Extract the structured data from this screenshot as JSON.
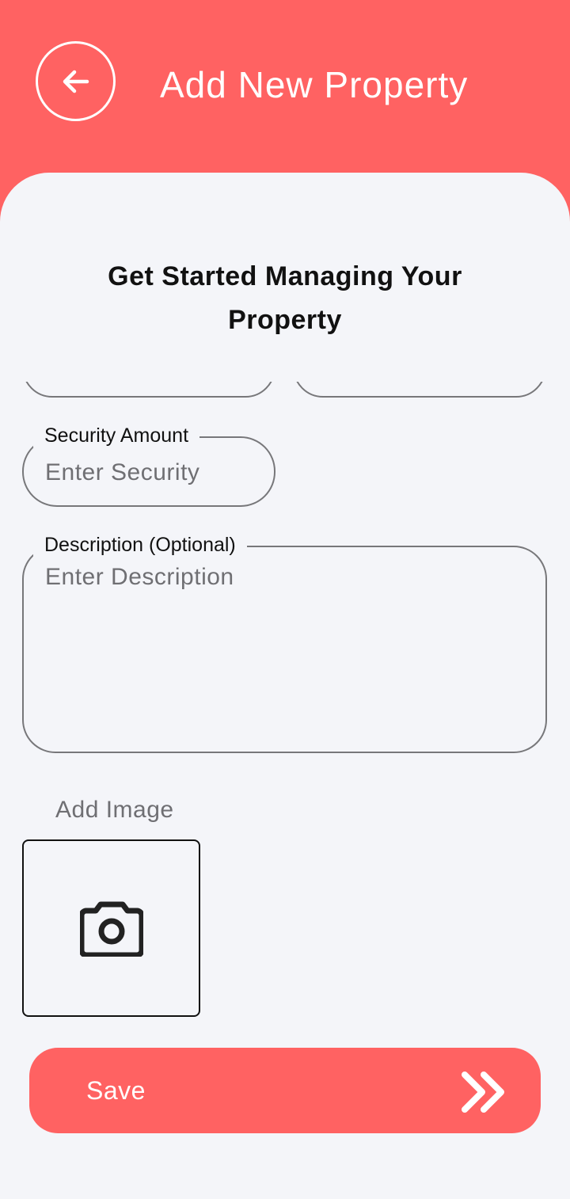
{
  "header": {
    "title": "Add New Property",
    "back_icon": "arrow-left-icon"
  },
  "main": {
    "subtitle": "Get Started Managing Your Property",
    "security": {
      "label": "Security Amount",
      "placeholder": "Enter Security",
      "value": ""
    },
    "description": {
      "label": "Description (Optional)",
      "placeholder": "Enter Description",
      "value": ""
    },
    "image": {
      "label": "Add Image",
      "icon": "camera-icon"
    },
    "save": {
      "label": "Save",
      "icon": "double-chevron-right-icon"
    }
  },
  "colors": {
    "accent": "#FF6262",
    "background": "#F4F5F9",
    "border": "#77777a",
    "placeholder": "#6f6f73"
  }
}
